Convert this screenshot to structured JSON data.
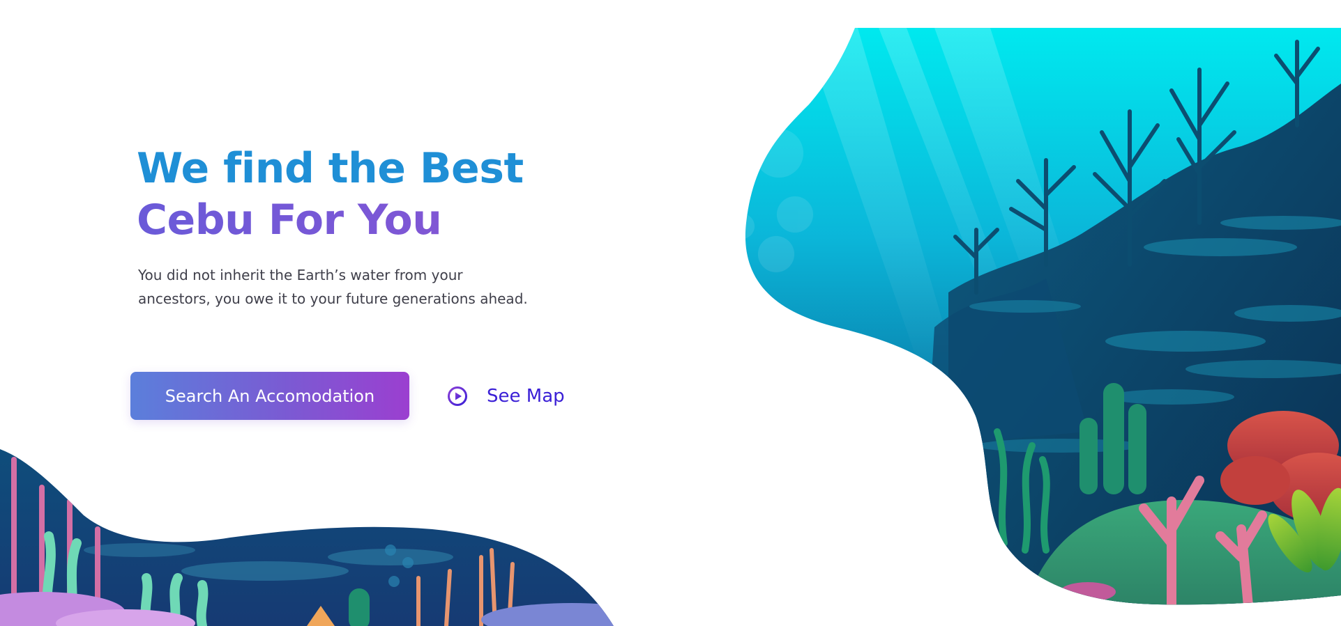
{
  "hero": {
    "headline_line1": "We find the Best",
    "headline_line2": "Cebu For You",
    "subtitle_line1": "You did not inherit the Earth’s water from your",
    "subtitle_line2": "ancestors, you owe it to your future generations ahead.",
    "primary_button_label": "Search An Accomodation",
    "secondary_link_label": "See Map",
    "secondary_link_icon": "play-circle-icon"
  },
  "colors": {
    "headline_blue": "#1f8fd6",
    "headline_purple": "#7a57d6",
    "button_gradient_start": "#5b7fdb",
    "button_gradient_end": "#9b3fd0",
    "link_color": "#3a1fd6",
    "ocean_top": "#00e8ee",
    "ocean_deep": "#0a3d5e"
  }
}
